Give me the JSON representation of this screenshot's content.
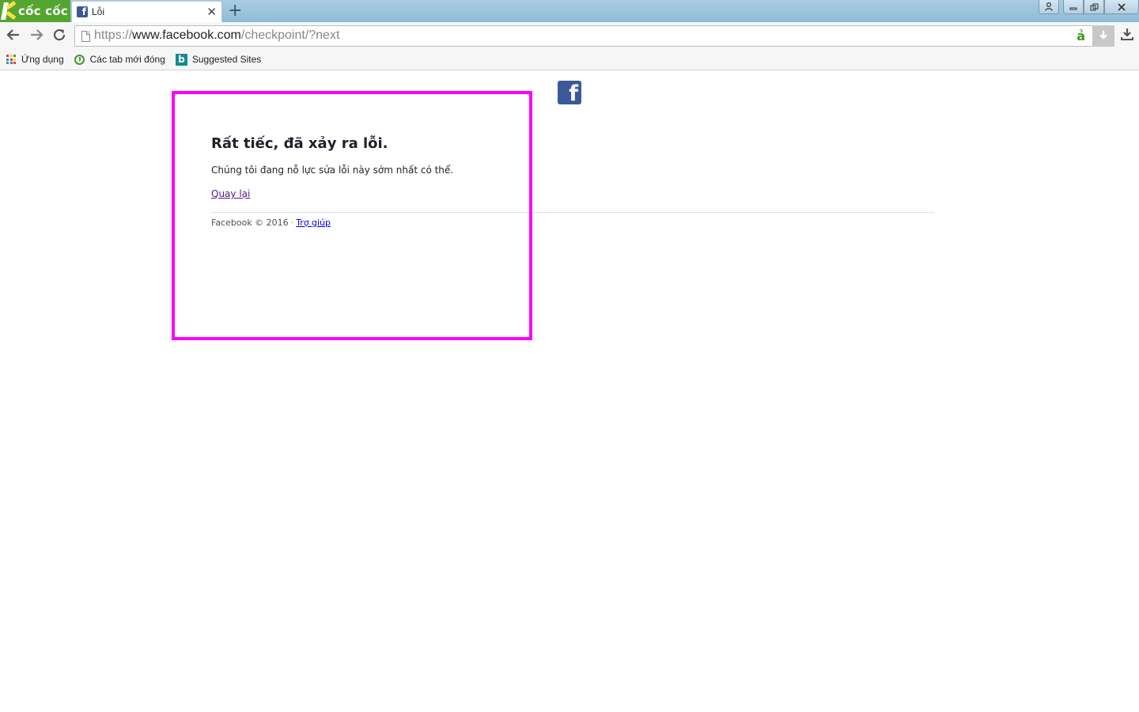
{
  "browser": {
    "brand": "cốc cốc",
    "tab": {
      "title": "Lỗi",
      "favicon": "facebook-icon"
    },
    "url": {
      "scheme": "https://",
      "host": "www.facebook.com",
      "path": "/checkpoint/?next"
    },
    "bookmarks": [
      {
        "label": "Ứng dụng",
        "icon": "apps-grid-icon"
      },
      {
        "label": "Các tab mới đóng",
        "icon": "recent-clock-icon"
      },
      {
        "label": "Suggested Sites",
        "icon": "bing-icon"
      }
    ],
    "accent_color": "#55a630"
  },
  "page": {
    "logo": "facebook-logo",
    "title": "Rất tiếc, đã xảy ra lỗi.",
    "description": "Chúng tôi đang nỗ lực sửa lỗi này sớm nhất có thể.",
    "back_link": "Quay lại",
    "footer": {
      "copyright": "Facebook © 2016",
      "separator": "·",
      "help_link": "Trợ giúp"
    },
    "highlight_color": "#ff00ff",
    "brand_color": "#3b5998"
  }
}
